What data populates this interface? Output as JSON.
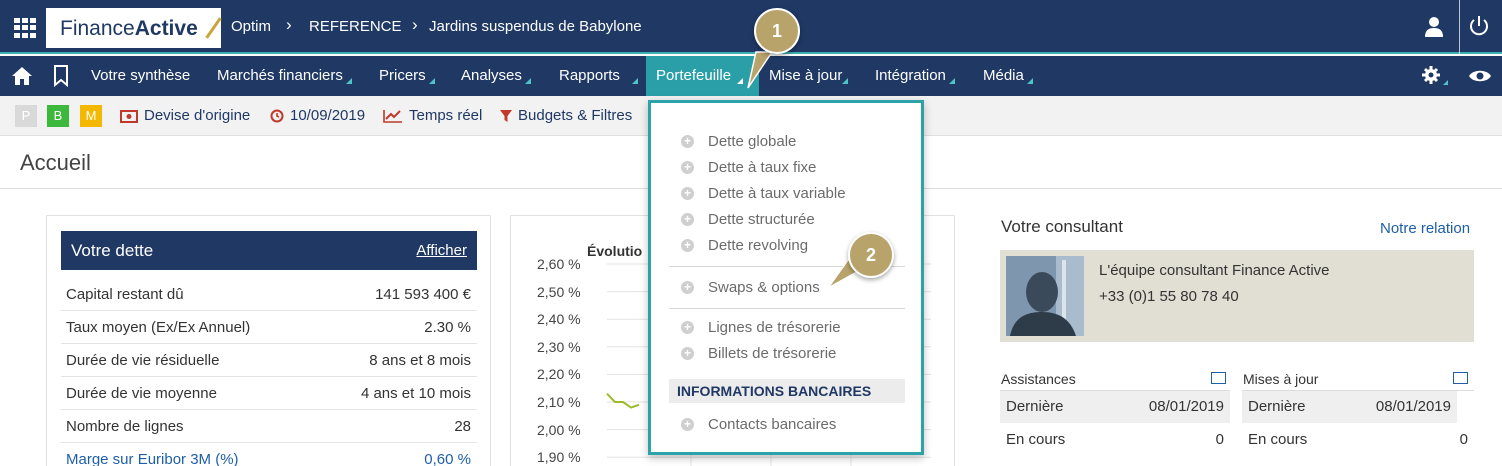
{
  "topbar": {
    "logo_light": "Finance",
    "logo_bold": "Active",
    "breadcrumb": [
      "Optim",
      "REFERENCE",
      "Jardins suspendus de Babylone"
    ],
    "icons": [
      "apps-grid-icon",
      "user-icon",
      "power-icon"
    ]
  },
  "nav": {
    "items": [
      "Votre synthèse",
      "Marchés financiers",
      "Pricers",
      "Analyses",
      "Rapports",
      "Portefeuille",
      "Mise à jour",
      "Intégration",
      "Média"
    ],
    "active": "Portefeuille",
    "icons": [
      "home-icon",
      "bookmark-icon",
      "gear-icon",
      "eye-icon"
    ]
  },
  "toolbar": {
    "badges": [
      {
        "label": "P",
        "color": "#d9d9d9"
      },
      {
        "label": "B",
        "color": "#3cb93c"
      },
      {
        "label": "M",
        "color": "#f5b800"
      }
    ],
    "currency": "Devise d'origine",
    "date": "10/09/2019",
    "realtime": "Temps réel",
    "filters": "Budgets & Filtres"
  },
  "page": {
    "title": "Accueil"
  },
  "debt": {
    "title": "Votre dette",
    "action": "Afficher",
    "rows": [
      {
        "label": "Capital restant dû",
        "value": "141 593 400 €"
      },
      {
        "label": "Taux moyen (Ex/Ex Annuel)",
        "value": "2.30 %"
      },
      {
        "label": "Durée de vie résiduelle",
        "value": "8 ans et 8 mois"
      },
      {
        "label": "Durée de vie moyenne",
        "value": "4 ans et 10 mois"
      },
      {
        "label": "Nombre de lignes",
        "value": "28"
      },
      {
        "label": "Marge sur Euribor 3M (%)",
        "value": "0,60 %"
      }
    ]
  },
  "chart_data": {
    "type": "line",
    "title": "Évolutio",
    "yticks": [
      "2,60 %",
      "2,50 %",
      "2,40 %",
      "2,30 %",
      "2,20 %",
      "2,10 %",
      "2,00 %",
      "1,90 %"
    ],
    "ylim": [
      1.9,
      2.6
    ],
    "series": [
      {
        "color": "#9bbb2c",
        "values": [
          2.13,
          2.1,
          2.1,
          2.08,
          2.09
        ]
      }
    ],
    "grid": true
  },
  "consultant": {
    "title": "Votre consultant",
    "link": "Notre relation",
    "name": "L'équipe consultant Finance Active",
    "phone": "+33 (0)1 55 80 78 40"
  },
  "assistances": {
    "title": "Assistances",
    "rows": [
      {
        "label": "Dernière",
        "value": "08/01/2019"
      },
      {
        "label": "En cours",
        "value": "0"
      }
    ]
  },
  "updates": {
    "title": "Mises à jour",
    "rows": [
      {
        "label": "Dernière",
        "value": "08/01/2019"
      },
      {
        "label": "En cours",
        "value": "0"
      }
    ]
  },
  "dropdown": {
    "group1": [
      "Dette globale",
      "Dette à taux fixe",
      "Dette à taux variable",
      "Dette structurée",
      "Dette revolving"
    ],
    "group2": [
      "Swaps & options"
    ],
    "group3": [
      "Lignes de trésorerie",
      "Billets de trésorerie"
    ],
    "section": "INFORMATIONS BANCAIRES",
    "group4": [
      "Contacts bancaires"
    ]
  },
  "callouts": [
    "1",
    "2"
  ]
}
